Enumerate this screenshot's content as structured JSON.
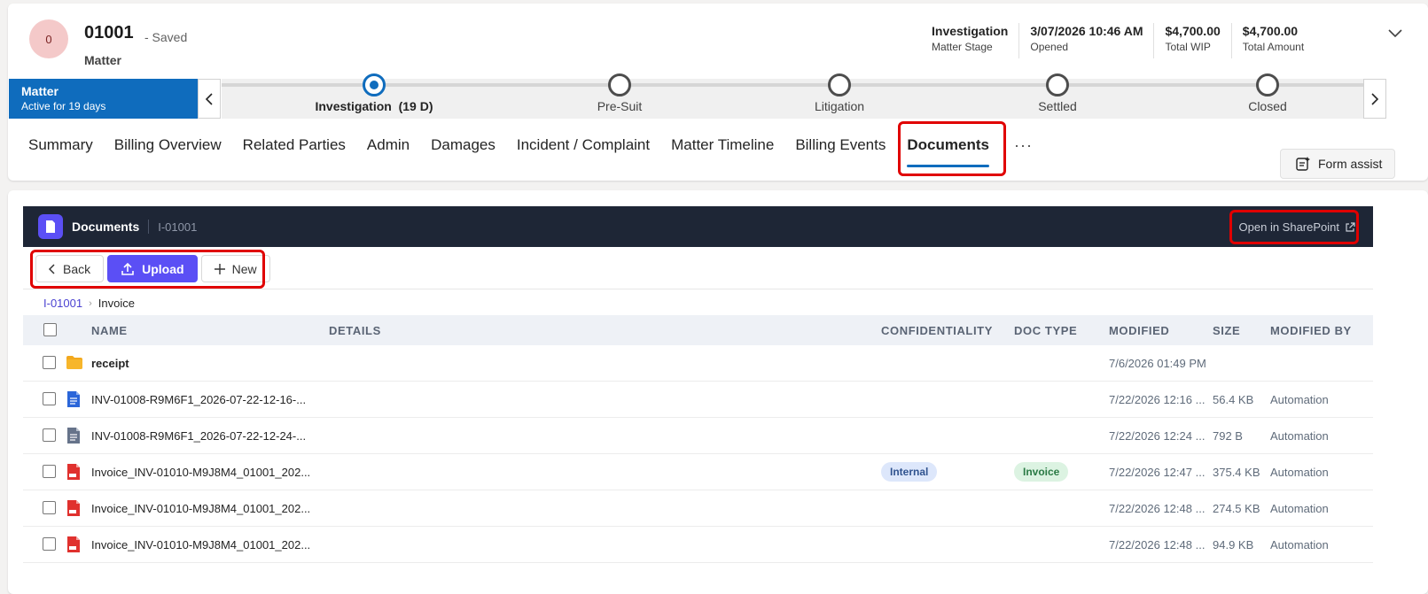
{
  "header": {
    "avatar_text": "0",
    "record_title": "01001",
    "saved_status": "- Saved",
    "record_type": "Matter",
    "summary": [
      {
        "value": "Investigation",
        "label": "Matter Stage"
      },
      {
        "value": "3/07/2026 10:46 AM",
        "label": "Opened"
      },
      {
        "value": "$4,700.00",
        "label": "Total WIP"
      },
      {
        "value": "$4,700.00",
        "label": "Total Amount"
      }
    ],
    "expand_icon": "chevron-down-icon"
  },
  "bpf": {
    "stage_name": "Matter",
    "active_for": "Active for 19 days",
    "stages": [
      {
        "label": "Investigation  (19 D)",
        "active": true
      },
      {
        "label": "Pre-Suit",
        "active": false
      },
      {
        "label": "Litigation",
        "active": false
      },
      {
        "label": "Settled",
        "active": false
      },
      {
        "label": "Closed",
        "active": false
      }
    ]
  },
  "tabs": [
    "Summary",
    "Billing Overview",
    "Related Parties",
    "Admin",
    "Damages",
    "Incident / Complaint",
    "Matter Timeline",
    "Billing Events",
    "Documents"
  ],
  "tabs_selected": "Documents",
  "tabs_more": "···",
  "form_assist": "Form assist",
  "documents": {
    "title": "Documents",
    "subtitle": "I-01001",
    "open_sharepoint": "Open in SharePoint",
    "toolbar": {
      "back": "Back",
      "upload": "Upload",
      "new": "New"
    },
    "breadcrumb": {
      "root": "I-01001",
      "current": "Invoice"
    },
    "columns": {
      "name": "NAME",
      "details": "DETAILS",
      "confidentiality": "CONFIDENTIALITY",
      "doc_type": "DOC TYPE",
      "modified": "MODIFIED",
      "size": "SIZE",
      "modified_by": "MODIFIED BY"
    },
    "rows": [
      {
        "icon": "folder-icon",
        "name": "receipt",
        "confidentiality": "",
        "doc_type": "",
        "modified": "7/6/2026 01:49 PM",
        "size": "",
        "modified_by": ""
      },
      {
        "icon": "word-doc-icon",
        "name": "INV-01008-R9M6F1_2026-07-22-12-16-...",
        "confidentiality": "",
        "doc_type": "",
        "modified": "7/22/2026 12:16 ...",
        "size": "56.4 KB",
        "modified_by": "Automation"
      },
      {
        "icon": "text-doc-icon",
        "name": "INV-01008-R9M6F1_2026-07-22-12-24-...",
        "confidentiality": "",
        "doc_type": "",
        "modified": "7/22/2026 12:24 ...",
        "size": "792 B",
        "modified_by": "Automation"
      },
      {
        "icon": "pdf-icon",
        "name": "Invoice_INV-01010-M9J8M4_01001_202...",
        "confidentiality": "Internal",
        "doc_type": "Invoice",
        "modified": "7/22/2026 12:47 ...",
        "size": "375.4 KB",
        "modified_by": "Automation"
      },
      {
        "icon": "pdf-icon",
        "name": "Invoice_INV-01010-M9J8M4_01001_202...",
        "confidentiality": "",
        "doc_type": "",
        "modified": "7/22/2026 12:48 ...",
        "size": "274.5 KB",
        "modified_by": "Automation"
      },
      {
        "icon": "pdf-icon",
        "name": "Invoice_INV-01010-M9J8M4_01001_202...",
        "confidentiality": "",
        "doc_type": "",
        "modified": "7/22/2026 12:48 ...",
        "size": "94.9 KB",
        "modified_by": "Automation"
      }
    ]
  },
  "colors": {
    "brand_blue": "#0f6cbd",
    "accent_purple": "#5b4ff5",
    "highlight_red": "#e00000",
    "docs_header_bg": "#1e2636"
  }
}
